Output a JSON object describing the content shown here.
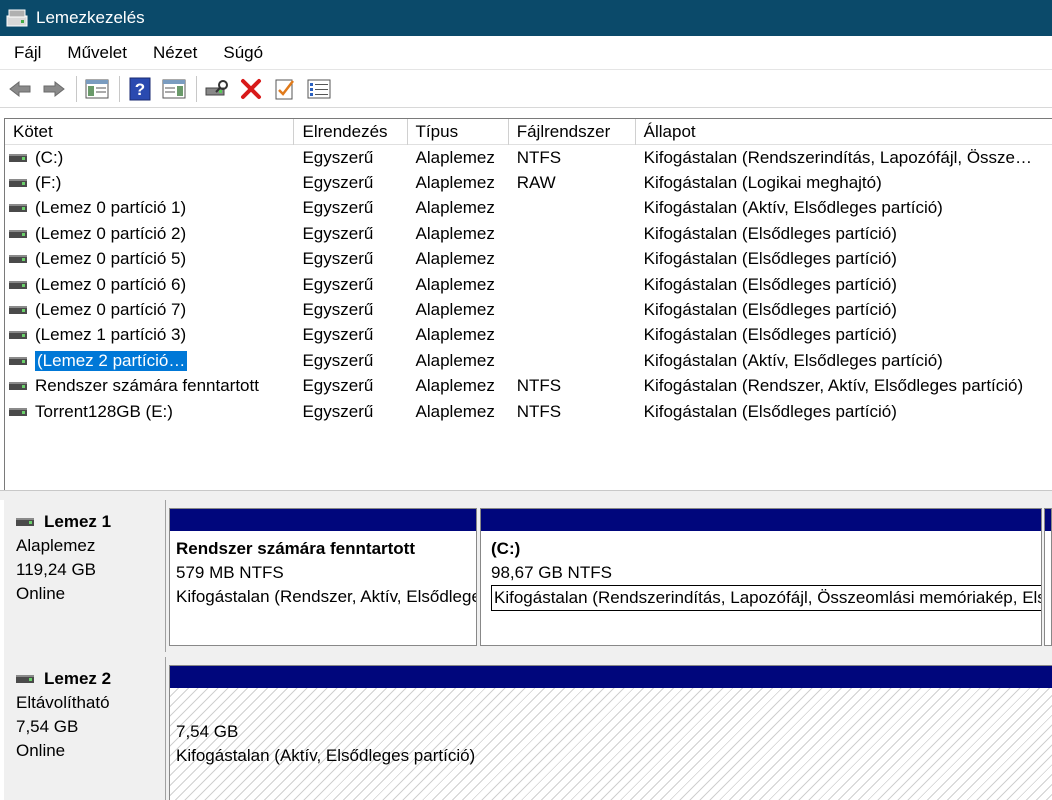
{
  "window": {
    "title": "Lemezkezelés"
  },
  "menu": [
    "Fájl",
    "Művelet",
    "Nézet",
    "Súgó"
  ],
  "list": {
    "columns": [
      "Kötet",
      "Elrendezés",
      "Típus",
      "Fájlrendszer",
      "Állapot"
    ],
    "rows": [
      {
        "volume": "(C:)",
        "layout": "Egyszerű",
        "type": "Alaplemez",
        "fs": "NTFS",
        "status": "Kifogástalan (Rendszerindítás, Lapozófájl, Össze…"
      },
      {
        "volume": "(F:)",
        "layout": "Egyszerű",
        "type": "Alaplemez",
        "fs": "RAW",
        "status": "Kifogástalan (Logikai meghajtó)"
      },
      {
        "volume": "(Lemez 0 partíció 1)",
        "layout": "Egyszerű",
        "type": "Alaplemez",
        "fs": "",
        "status": "Kifogástalan (Aktív, Elsődleges partíció)"
      },
      {
        "volume": "(Lemez 0 partíció 2)",
        "layout": "Egyszerű",
        "type": "Alaplemez",
        "fs": "",
        "status": "Kifogástalan (Elsődleges partíció)"
      },
      {
        "volume": "(Lemez 0 partíció 5)",
        "layout": "Egyszerű",
        "type": "Alaplemez",
        "fs": "",
        "status": "Kifogástalan (Elsődleges partíció)"
      },
      {
        "volume": "(Lemez 0 partíció 6)",
        "layout": "Egyszerű",
        "type": "Alaplemez",
        "fs": "",
        "status": "Kifogástalan (Elsődleges partíció)"
      },
      {
        "volume": "(Lemez 0 partíció 7)",
        "layout": "Egyszerű",
        "type": "Alaplemez",
        "fs": "",
        "status": "Kifogástalan (Elsődleges partíció)"
      },
      {
        "volume": "(Lemez 1 partíció 3)",
        "layout": "Egyszerű",
        "type": "Alaplemez",
        "fs": "",
        "status": "Kifogástalan (Elsődleges partíció)"
      },
      {
        "volume": "(Lemez 2 partíció…",
        "layout": "Egyszerű",
        "type": "Alaplemez",
        "fs": "",
        "status": "Kifogástalan (Aktív, Elsődleges partíció)",
        "selected": true
      },
      {
        "volume": "Rendszer számára fenntartott",
        "layout": "Egyszerű",
        "type": "Alaplemez",
        "fs": "NTFS",
        "status": "Kifogástalan (Rendszer, Aktív, Elsődleges partíció)"
      },
      {
        "volume": "Torrent128GB (E:)",
        "layout": "Egyszerű",
        "type": "Alaplemez",
        "fs": "NTFS",
        "status": "Kifogástalan (Elsődleges partíció)"
      }
    ]
  },
  "disks": [
    {
      "name": "Lemez 1",
      "kind": "Alaplemez",
      "size": "119,24 GB",
      "state": "Online",
      "partitions": [
        {
          "name": "Rendszer számára fenntartott",
          "size": "579 MB NTFS",
          "status": "Kifogástalan (Rendszer, Aktív, Elsődleges partíció)"
        },
        {
          "name": "(C:)",
          "size": "98,67 GB NTFS",
          "status": "Kifogástalan (Rendszerindítás, Lapozófájl, Összeomlási memóriakép, Elsődleges partíció)"
        }
      ]
    },
    {
      "name": "Lemez 2",
      "kind": "Eltávolítható",
      "size": "7,54 GB",
      "state": "Online",
      "partitions": [
        {
          "name": "",
          "size": "7,54 GB",
          "status": "Kifogástalan (Aktív, Elsődleges partíció)"
        }
      ]
    }
  ],
  "toolbar": [
    "back-arrow-icon",
    "forward-arrow-icon",
    "console-tree-icon",
    "help-icon",
    "action-pane-icon",
    "connect-icon",
    "delete-icon",
    "properties-icon",
    "list-view-icon"
  ]
}
